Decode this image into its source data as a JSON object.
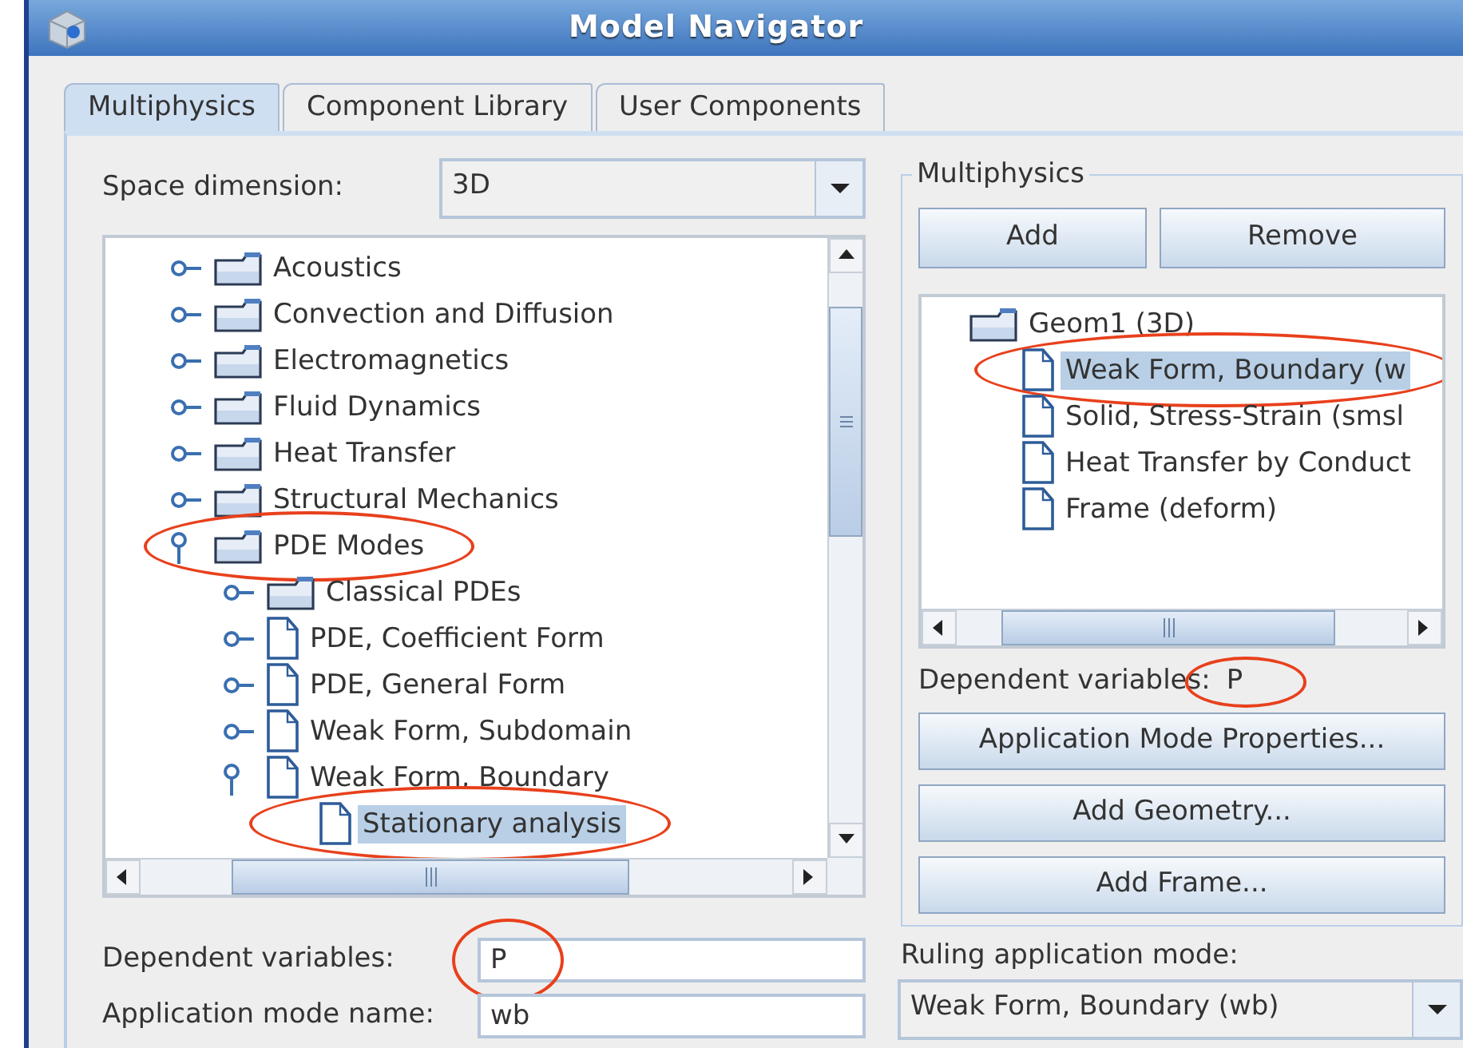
{
  "window": {
    "title": "Model Navigator"
  },
  "tabs": [
    {
      "label": "Multiphysics",
      "selected": true
    },
    {
      "label": "Component Library",
      "selected": false
    },
    {
      "label": "User Components",
      "selected": false
    }
  ],
  "space_dimension": {
    "label": "Space dimension:",
    "value": "3D"
  },
  "tree": [
    {
      "label": "Acoustics",
      "kind": "folder",
      "expanded": false,
      "selected": false,
      "circled": false
    },
    {
      "label": "Convection and Diffusion",
      "kind": "folder",
      "expanded": false,
      "selected": false,
      "circled": false
    },
    {
      "label": "Electromagnetics",
      "kind": "folder",
      "expanded": false,
      "selected": false,
      "circled": false
    },
    {
      "label": "Fluid Dynamics",
      "kind": "folder",
      "expanded": false,
      "selected": false,
      "circled": false
    },
    {
      "label": "Heat Transfer",
      "kind": "folder",
      "expanded": false,
      "selected": false,
      "circled": false
    },
    {
      "label": "Structural Mechanics",
      "kind": "folder",
      "expanded": false,
      "selected": false,
      "circled": false
    },
    {
      "label": "PDE Modes",
      "kind": "folder",
      "expanded": true,
      "selected": false,
      "circled": true,
      "children": [
        {
          "label": "Classical PDEs",
          "kind": "folder",
          "expanded": false,
          "selected": false,
          "circled": false
        },
        {
          "label": "PDE, Coefficient Form",
          "kind": "mode",
          "expanded": false,
          "selected": false,
          "circled": false
        },
        {
          "label": "PDE, General Form",
          "kind": "mode",
          "expanded": false,
          "selected": false,
          "circled": false
        },
        {
          "label": "Weak Form, Subdomain",
          "kind": "mode",
          "expanded": false,
          "selected": false,
          "circled": false
        },
        {
          "label": "Weak Form, Boundary",
          "kind": "mode",
          "expanded": true,
          "selected": false,
          "circled": false,
          "children": [
            {
              "label": "Stationary analysis",
              "kind": "mode",
              "selected": true,
              "circled": true
            }
          ]
        }
      ]
    }
  ],
  "dependent_variables": {
    "label": "Dependent variables:",
    "value": "P",
    "circled": true
  },
  "application_mode_name": {
    "label": "Application mode name:",
    "value": "wb"
  },
  "multiphysics": {
    "title": "Multiphysics",
    "buttons": [
      "Add",
      "Remove"
    ],
    "tree": [
      {
        "label": "Geom1 (3D)",
        "kind": "folder",
        "selected": false,
        "circled": false,
        "children": [
          {
            "label": "Weak Form, Boundary (w",
            "kind": "mode",
            "selected": true,
            "circled": true
          },
          {
            "label": "Solid, Stress-Strain (smsl",
            "kind": "mode",
            "selected": false,
            "circled": false
          },
          {
            "label": "Heat Transfer by Conduct",
            "kind": "mode",
            "selected": false,
            "circled": false
          },
          {
            "label": "Frame (deform)",
            "kind": "mode",
            "selected": false,
            "circled": false
          }
        ]
      }
    ],
    "dependent_variables": {
      "label": "Dependent variables:",
      "value": "P",
      "circled": true
    },
    "actions": [
      "Application Mode Properties...",
      "Add Geometry...",
      "Add Frame..."
    ]
  },
  "ruling_application_mode": {
    "label": "Ruling application mode:",
    "value": "Weak Form, Boundary (wb)"
  }
}
